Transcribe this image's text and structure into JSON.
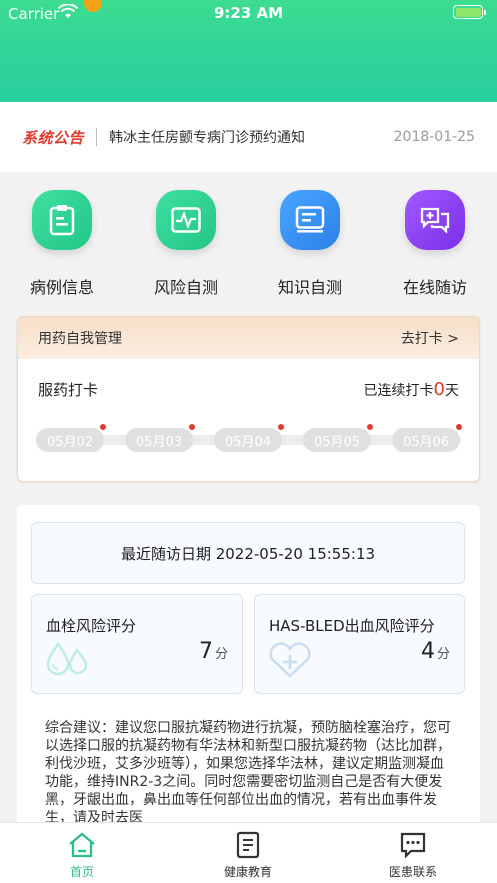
{
  "status_bar": {
    "carrier": "Carrier",
    "time": "9:23 AM"
  },
  "notice": {
    "tag": "系统公告",
    "text": "韩冰主任房颤专病门诊预约通知",
    "date": "2018-01-25"
  },
  "quick_actions": [
    {
      "label": "病例信息",
      "icon": "clipboard-icon",
      "color": "#2fcf8f"
    },
    {
      "label": "风险自测",
      "icon": "heartbeat-icon",
      "color": "#2fcf8f"
    },
    {
      "label": "知识自测",
      "icon": "document-icon",
      "color": "#2f8bf0"
    },
    {
      "label": "在线随访",
      "icon": "chat-plus-icon",
      "color": "#8a3cf0"
    }
  ],
  "medication": {
    "title": "用药自我管理",
    "checkin_link": "去打卡 >",
    "checkin_label": "服药打卡",
    "streak_prefix": "已连续打卡",
    "streak_count": "0",
    "streak_unit": "天",
    "days": [
      "05月02",
      "05月03",
      "05月04",
      "05月05",
      "05月06"
    ]
  },
  "followup": {
    "text": "最近随访日期 2022-05-20 15:55:13"
  },
  "scores": [
    {
      "title": "血栓风险评分",
      "value": "7",
      "unit": "分",
      "icon": "water-drops-icon"
    },
    {
      "title": "HAS-BLED出血风险评分",
      "value": "4",
      "unit": "分",
      "icon": "heart-plus-icon"
    }
  ],
  "advice": "综合建议：建议您口服抗凝药物进行抗凝，预防脑栓塞治疗，您可以选择口服的抗凝药物有华法林和新型口服抗凝药物（达比加群，利伐沙班，艾多沙班等），如果您选择华法林，建议定期监测凝血功能，维持INR2-3之间。同时您需要密切监测自己是否有大便发黑，牙龈出血，鼻出血等任何部位出血的情况，若有出血事件发生，请及时去医",
  "tabs": [
    {
      "label": "首页",
      "icon": "home-icon",
      "active": true
    },
    {
      "label": "健康教育",
      "icon": "notebook-icon",
      "active": false
    },
    {
      "label": "医患联系",
      "icon": "message-icon",
      "active": false
    }
  ],
  "colors": {
    "primary": "#2ed39a",
    "accent_red": "#e23b2e",
    "tab_active": "#2dbf84"
  }
}
